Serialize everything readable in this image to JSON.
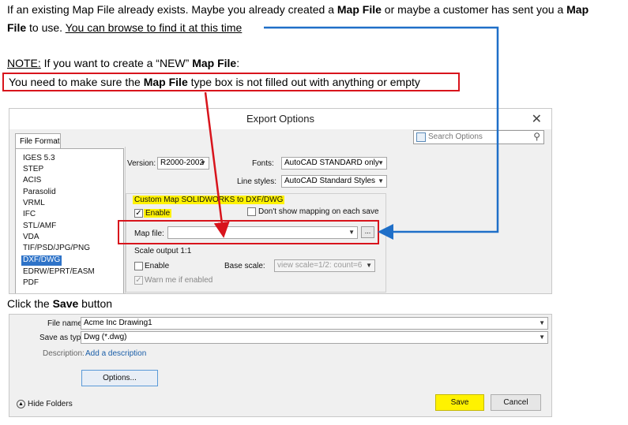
{
  "doc": {
    "line1_a": "If an existing Map File already exists.  Maybe you already created a ",
    "line1_b": "Map File",
    "line1_c": " or maybe a customer has sent you a ",
    "line1_d": "Map",
    "line2_a": "File",
    "line2_b": " to use.  ",
    "line2_c": "You can browse to find it at this time",
    "note_label": "NOTE:",
    "note_a": "  If you want to create a “NEW” ",
    "note_b": "Map File",
    "note_c": ":",
    "box_a": "You need to make sure the ",
    "box_b": "Map File",
    "box_c": " type box is not filled out with anything or empty",
    "click_a": "Click the ",
    "click_b": "Save",
    "click_c": " button"
  },
  "export_dialog": {
    "title": "Export Options",
    "close": "✕",
    "tab": "File Format",
    "search_placeholder": "Search Options",
    "formats": [
      "IGES 5.3",
      "STEP",
      "ACIS",
      "Parasolid",
      "VRML",
      "IFC",
      "STL/AMF",
      "VDA",
      "TIF/PSD/JPG/PNG",
      "DXF/DWG",
      "EDRW/EPRT/EASM",
      "PDF"
    ],
    "selected_format": "DXF/DWG",
    "version_label": "Version:",
    "version_value": "R2000-2002",
    "fonts_label": "Fonts:",
    "fonts_value": "AutoCAD STANDARD only",
    "linestyles_label": "Line styles:",
    "linestyles_value": "AutoCAD Standard Styles",
    "custom_map_label": "Custom Map SOLIDWORKS to DXF/DWG",
    "enable_label": "Enable",
    "dont_show_label": "Don't show mapping on each save",
    "mapfile_label": "Map file:",
    "mapfile_value": "",
    "browse_label": "...",
    "scale_label": "Scale output 1:1",
    "scale_enable_label": "Enable",
    "base_scale_label": "Base scale:",
    "base_scale_value": "view scale=1/2: count=6",
    "warn_label": "Warn me if enabled"
  },
  "save_dialog": {
    "filename_label": "File name:",
    "filename_value": "Acme Inc Drawing1",
    "saveas_label": "Save as type:",
    "saveas_value": "Dwg (*.dwg)",
    "description_label": "Description:",
    "description_link": "Add a description",
    "options_button": "Options...",
    "hide_folders": "Hide Folders",
    "save_button": "Save",
    "cancel_button": "Cancel"
  },
  "colors": {
    "red_box": "#d8141c",
    "blue_arrow": "#1f6fc8",
    "highlight": "#fff200",
    "selection": "#2e73c8"
  }
}
